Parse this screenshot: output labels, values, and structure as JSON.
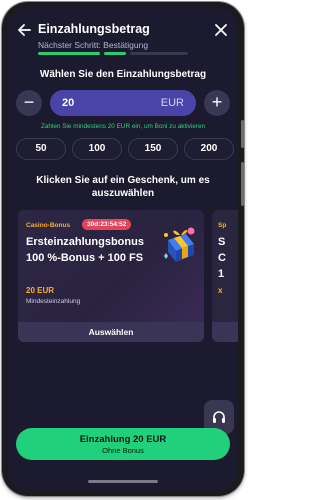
{
  "header": {
    "title": "Einzahlungsbetrag",
    "subtitle": "Nächster Schritt: Bestätigung"
  },
  "amount_section": {
    "title": "Wählen Sie den Einzahlungsbetrag",
    "minus_label": "−",
    "plus_label": "+",
    "value": "20",
    "currency": "EUR",
    "hint": "Zahlen Sie mindestens 20 EUR ein, um Bonl zu aktivieren"
  },
  "presets": [
    "50",
    "100",
    "150",
    "200"
  ],
  "gift_section": {
    "title": "Klicken Sie auf ein Geschenk, um es auszuwählen"
  },
  "bonus_card": {
    "type_label": "Casino-Bonus",
    "timer": "30d:23:54:52",
    "title": "Ersteinzahlungsbonus",
    "subtitle": "100 %-Bonus + 100 FS",
    "min_amount": "20 EUR",
    "min_label": "Mindesteinzahlung",
    "select_label": "Auswählen"
  },
  "peek_card": {
    "type_label": "Sp",
    "line1": "S",
    "line2": "C",
    "line3": "1",
    "amount": "x"
  },
  "deposit_button": {
    "label": "Einzahlung 20 EUR",
    "sublabel": "Ohne Bonus"
  },
  "colors": {
    "background": "#1c1a2e",
    "accent_green": "#21d07a",
    "input_purple": "#4a44a8",
    "bonus_orange": "#ffb020",
    "timer_red": "#e0455a"
  },
  "icons": [
    "back-arrow-icon",
    "close-icon",
    "gift-box-icon",
    "headset-icon"
  ]
}
